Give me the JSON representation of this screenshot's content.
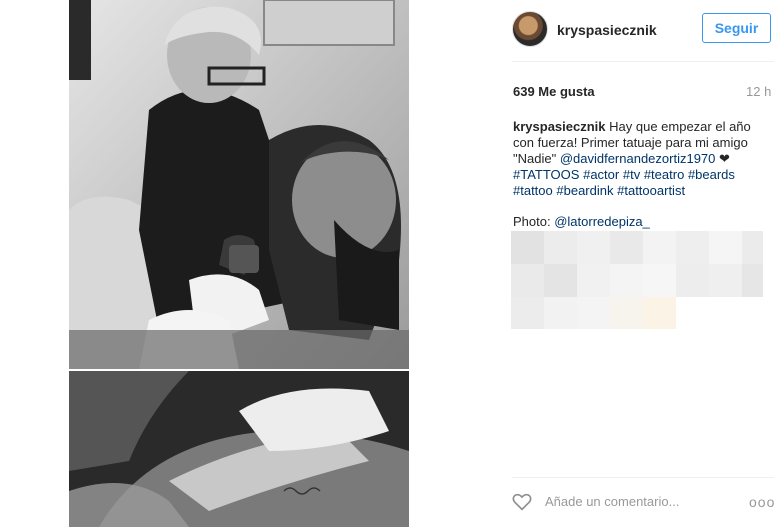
{
  "post": {
    "username": "kryspasiecznik",
    "follow_label": "Seguir",
    "likes": "639 Me gusta",
    "time": "12 h",
    "caption_user": "kryspasiecznik",
    "caption_text_1": " Hay que empezar el año con fuerza! Primer tatuaje para mi amigo \"Nadie\" ",
    "caption_mention": "@davidfernandezortiz1970",
    "caption_heart": " ❤ ",
    "hashtags": [
      "#TATTOOS",
      "#actor",
      "#tv",
      "#teatro",
      "#beards",
      "#tattoo",
      "#beardink",
      "#tattooartist"
    ],
    "photo_label": "Photo: ",
    "photo_mention": "@latorredepiza_"
  },
  "comment_box": {
    "placeholder": "Añade un comentario...",
    "more_label": "ooo"
  },
  "icons": {
    "like": "heart-outline-icon",
    "more": "more-horizontal-icon"
  },
  "colors": {
    "follow_accent": "#3897f0",
    "link": "#003569",
    "muted": "#999999"
  }
}
